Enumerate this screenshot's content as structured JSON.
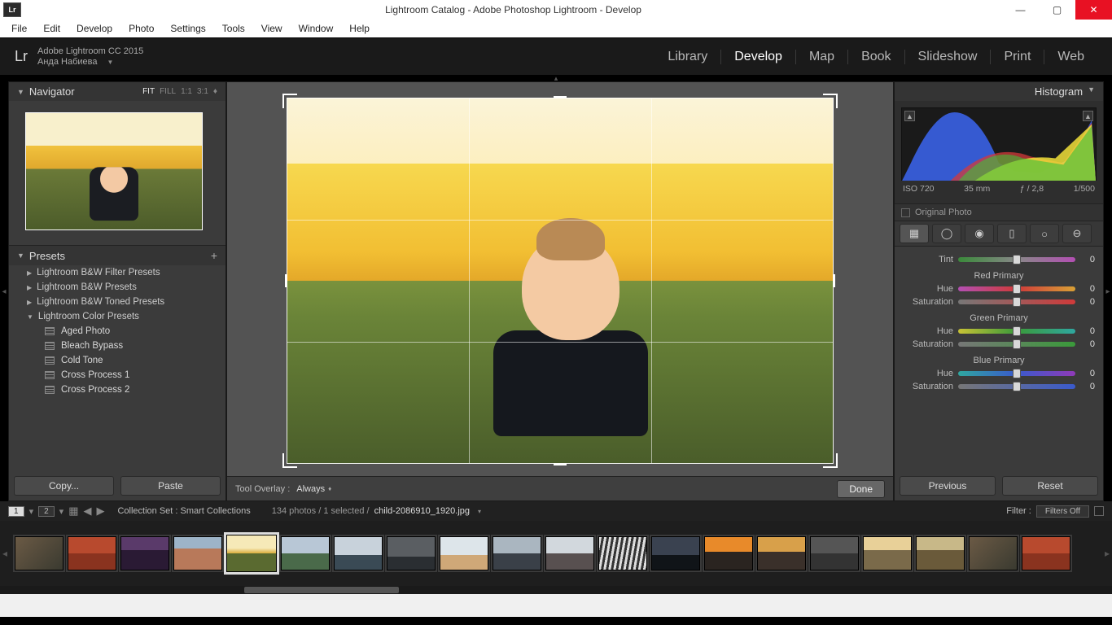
{
  "window": {
    "title": "Lightroom Catalog - Adobe Photoshop Lightroom - Develop",
    "app_icon": "Lr"
  },
  "menubar": [
    "File",
    "Edit",
    "Develop",
    "Photo",
    "Settings",
    "Tools",
    "View",
    "Window",
    "Help"
  ],
  "identity": {
    "logo": "Lr",
    "line1": "Adobe Lightroom CC 2015",
    "line2": "Анда Набиева"
  },
  "modules": [
    {
      "label": "Library",
      "active": false
    },
    {
      "label": "Develop",
      "active": true
    },
    {
      "label": "Map",
      "active": false
    },
    {
      "label": "Book",
      "active": false
    },
    {
      "label": "Slideshow",
      "active": false
    },
    {
      "label": "Print",
      "active": false
    },
    {
      "label": "Web",
      "active": false
    }
  ],
  "navigator": {
    "title": "Navigator",
    "zoom_opts": [
      "FIT",
      "FILL",
      "1:1",
      "3:1"
    ],
    "zoom_active": "FIT"
  },
  "presets": {
    "title": "Presets",
    "folders": [
      {
        "label": "Lightroom B&W Filter Presets",
        "open": false
      },
      {
        "label": "Lightroom B&W Presets",
        "open": false
      },
      {
        "label": "Lightroom B&W Toned Presets",
        "open": false
      },
      {
        "label": "Lightroom Color Presets",
        "open": true
      }
    ],
    "items": [
      "Aged Photo",
      "Bleach Bypass",
      "Cold Tone",
      "Cross Process 1",
      "Cross Process 2"
    ]
  },
  "left_buttons": {
    "copy": "Copy...",
    "paste": "Paste"
  },
  "toolbar": {
    "overlay_label": "Tool Overlay :",
    "overlay_value": "Always",
    "done": "Done"
  },
  "histogram": {
    "title": "Histogram",
    "iso": "ISO 720",
    "focal": "35 mm",
    "aperture": "ƒ / 2,8",
    "shutter": "1/500",
    "original": "Original Photo"
  },
  "sliders": {
    "tint": {
      "label": "Tint",
      "value": "0"
    },
    "red": {
      "title": "Red Primary",
      "hue": {
        "label": "Hue",
        "value": "0"
      },
      "sat": {
        "label": "Saturation",
        "value": "0"
      }
    },
    "green": {
      "title": "Green Primary",
      "hue": {
        "label": "Hue",
        "value": "0"
      },
      "sat": {
        "label": "Saturation",
        "value": "0"
      }
    },
    "blue": {
      "title": "Blue Primary",
      "hue": {
        "label": "Hue",
        "value": "0"
      },
      "sat": {
        "label": "Saturation",
        "value": "0"
      }
    }
  },
  "right_buttons": {
    "previous": "Previous",
    "reset": "Reset"
  },
  "filmstrip_bar": {
    "primary": "1",
    "secondary": "2",
    "path_label": "Collection Set : Smart Collections",
    "count": "134 photos / 1 selected /",
    "filename": "child-2086910_1920.jpg",
    "filter_label": "Filter :",
    "filter_value": "Filters Off"
  }
}
